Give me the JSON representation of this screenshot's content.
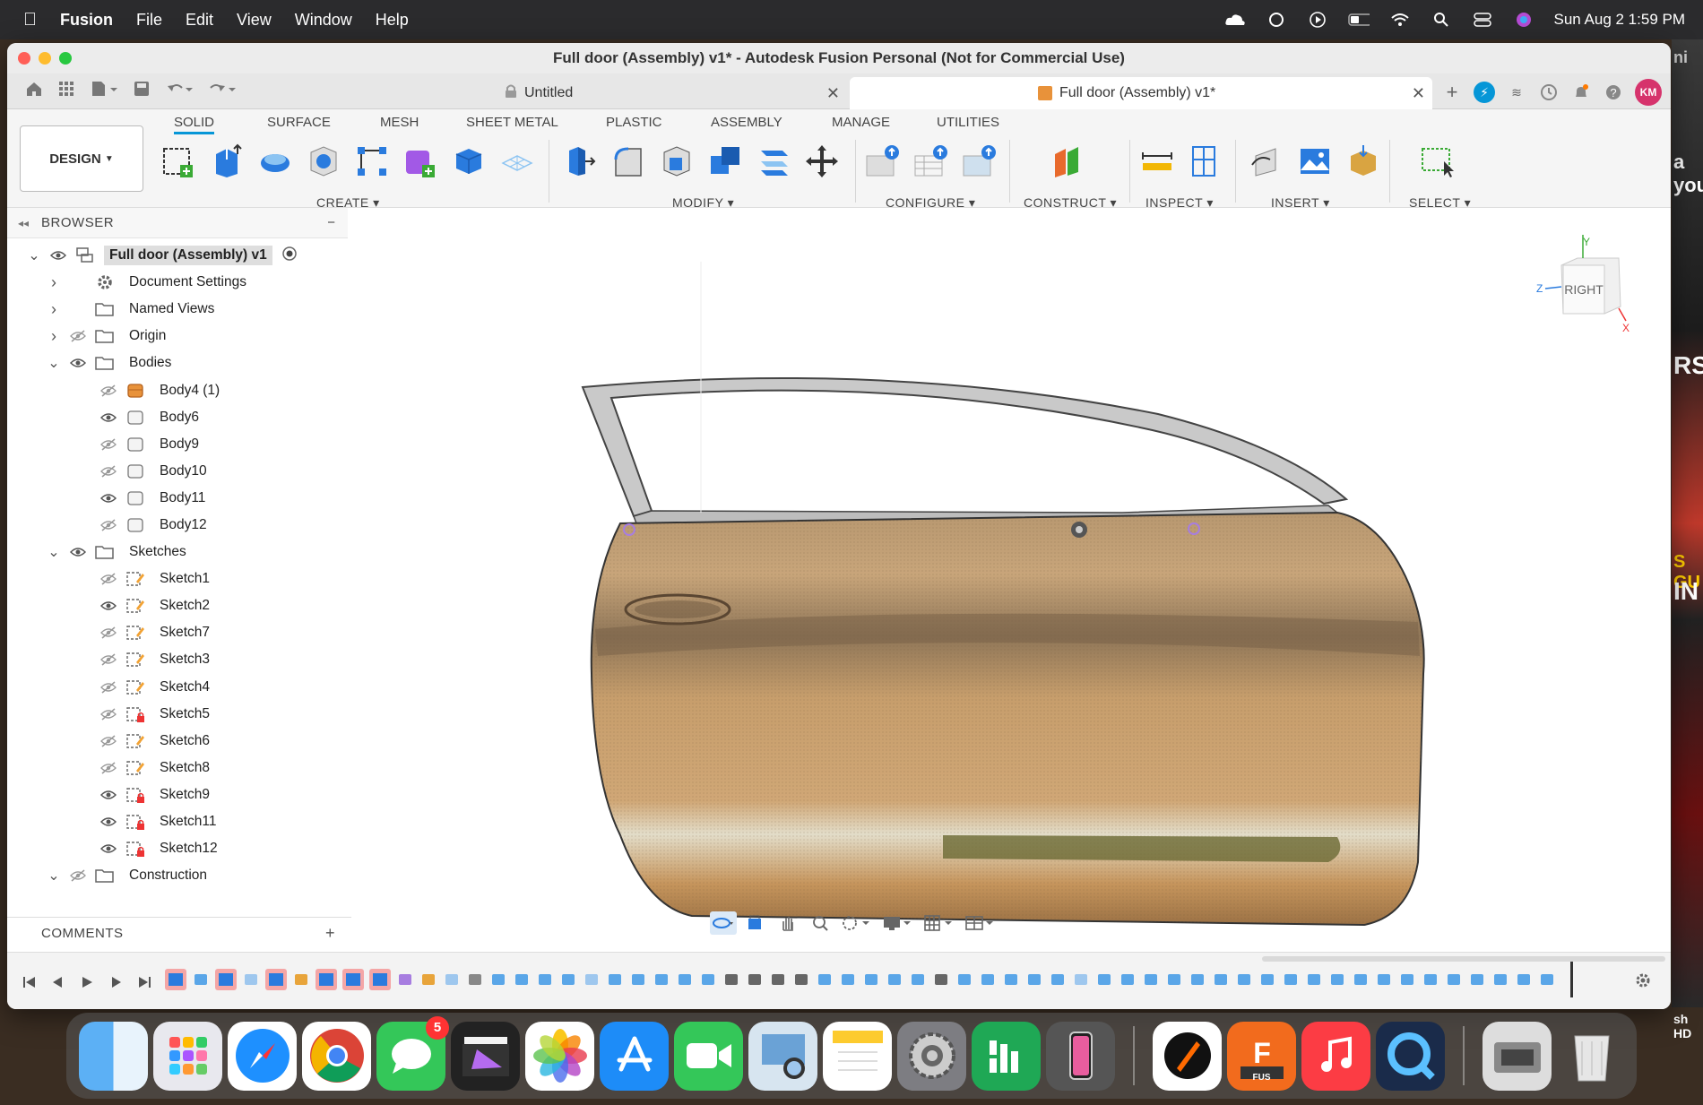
{
  "menubar": {
    "app": "Fusion",
    "items": [
      "File",
      "Edit",
      "View",
      "Window",
      "Help"
    ],
    "datetime": "Sun Aug 2  1:59 PM"
  },
  "window": {
    "title": "Full door (Assembly) v1* - Autodesk Fusion Personal (Not for Commercial Use)"
  },
  "tabs": [
    {
      "label": "Untitled"
    },
    {
      "label": "Full door (Assembly) v1*"
    }
  ],
  "user": {
    "initials": "KM"
  },
  "toolbar": {
    "workspace": "DESIGN",
    "tabs": [
      "SOLID",
      "SURFACE",
      "MESH",
      "SHEET METAL",
      "PLASTIC",
      "ASSEMBLY",
      "MANAGE",
      "UTILITIES"
    ],
    "active_tab": "SOLID",
    "groups": [
      "CREATE",
      "MODIFY",
      "CONFIGURE",
      "CONSTRUCT",
      "INSPECT",
      "INSERT",
      "SELECT"
    ]
  },
  "browser": {
    "title": "BROWSER",
    "root": "Full door (Assembly) v1",
    "items": [
      {
        "label": "Document Settings"
      },
      {
        "label": "Named Views"
      },
      {
        "label": "Origin"
      },
      {
        "label": "Bodies"
      },
      {
        "label": "Body4 (1)"
      },
      {
        "label": "Body6"
      },
      {
        "label": "Body9"
      },
      {
        "label": "Body10"
      },
      {
        "label": "Body11"
      },
      {
        "label": "Body12"
      },
      {
        "label": "Sketches"
      },
      {
        "label": "Sketch1"
      },
      {
        "label": "Sketch2"
      },
      {
        "label": "Sketch7"
      },
      {
        "label": "Sketch3"
      },
      {
        "label": "Sketch4"
      },
      {
        "label": "Sketch5"
      },
      {
        "label": "Sketch6"
      },
      {
        "label": "Sketch8"
      },
      {
        "label": "Sketch9"
      },
      {
        "label": "Sketch11"
      },
      {
        "label": "Sketch12"
      },
      {
        "label": "Construction"
      }
    ]
  },
  "comments": {
    "title": "COMMENTS"
  },
  "viewcube": {
    "face": "RIGHT",
    "axes": [
      "Y",
      "Z",
      "X"
    ]
  },
  "dock": {
    "messages_badge": "5",
    "fusion_label": "FUS"
  },
  "right_edge_text": [
    "ni",
    "a you",
    "RS",
    "S GU",
    "IN",
    "sh HD"
  ]
}
